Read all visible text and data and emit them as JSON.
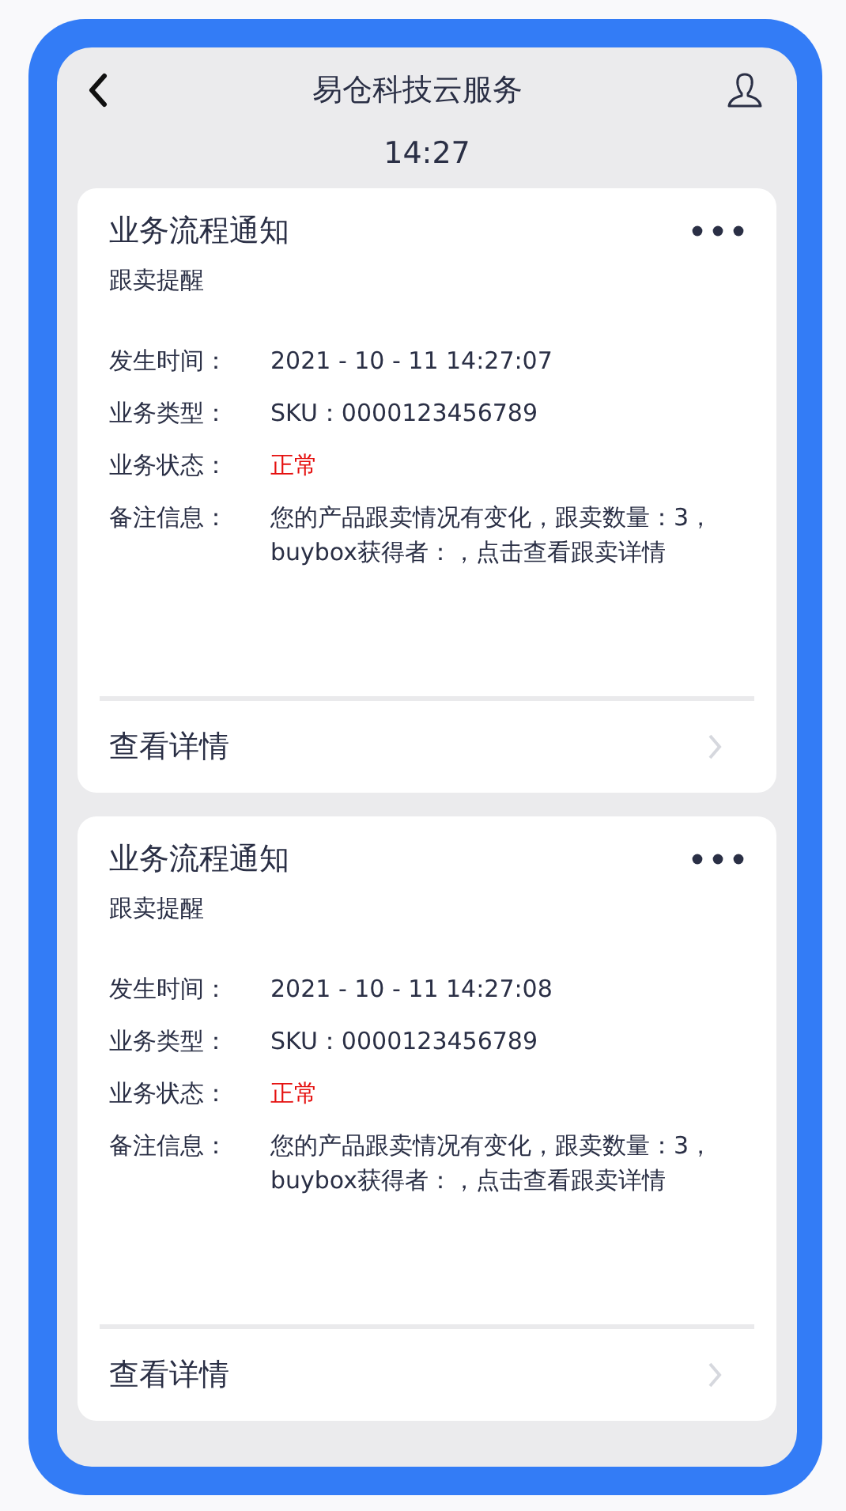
{
  "header": {
    "title": "易仓科技云服务"
  },
  "time": "14:27",
  "messages": [
    {
      "title": "业务流程通知",
      "subtitle": "跟卖提醒",
      "fields": [
        {
          "label": "发生时间：",
          "value": "2021 - 10 - 11   14:27:07",
          "kind": "text"
        },
        {
          "label": "业务类型：",
          "value": "SKU：0000123456789",
          "kind": "text"
        },
        {
          "label": "业务状态：",
          "value": "正常",
          "kind": "status"
        },
        {
          "label": "备注信息：",
          "value": "您的产品跟卖情况有变化，跟卖数量：3，buybox获得者：，点击查看跟卖详情",
          "kind": "text"
        }
      ],
      "link": "查看详情"
    },
    {
      "title": "业务流程通知",
      "subtitle": "跟卖提醒",
      "fields": [
        {
          "label": "发生时间：",
          "value": "2021 - 10 - 11   14:27:08",
          "kind": "text"
        },
        {
          "label": "业务类型：",
          "value": "SKU：0000123456789",
          "kind": "text"
        },
        {
          "label": "业务状态：",
          "value": "正常",
          "kind": "status"
        },
        {
          "label": "备注信息：",
          "value": "您的产品跟卖情况有变化，跟卖数量：3，buybox获得者：，点击查看跟卖详情",
          "kind": "text"
        }
      ],
      "link": "查看详情"
    }
  ]
}
